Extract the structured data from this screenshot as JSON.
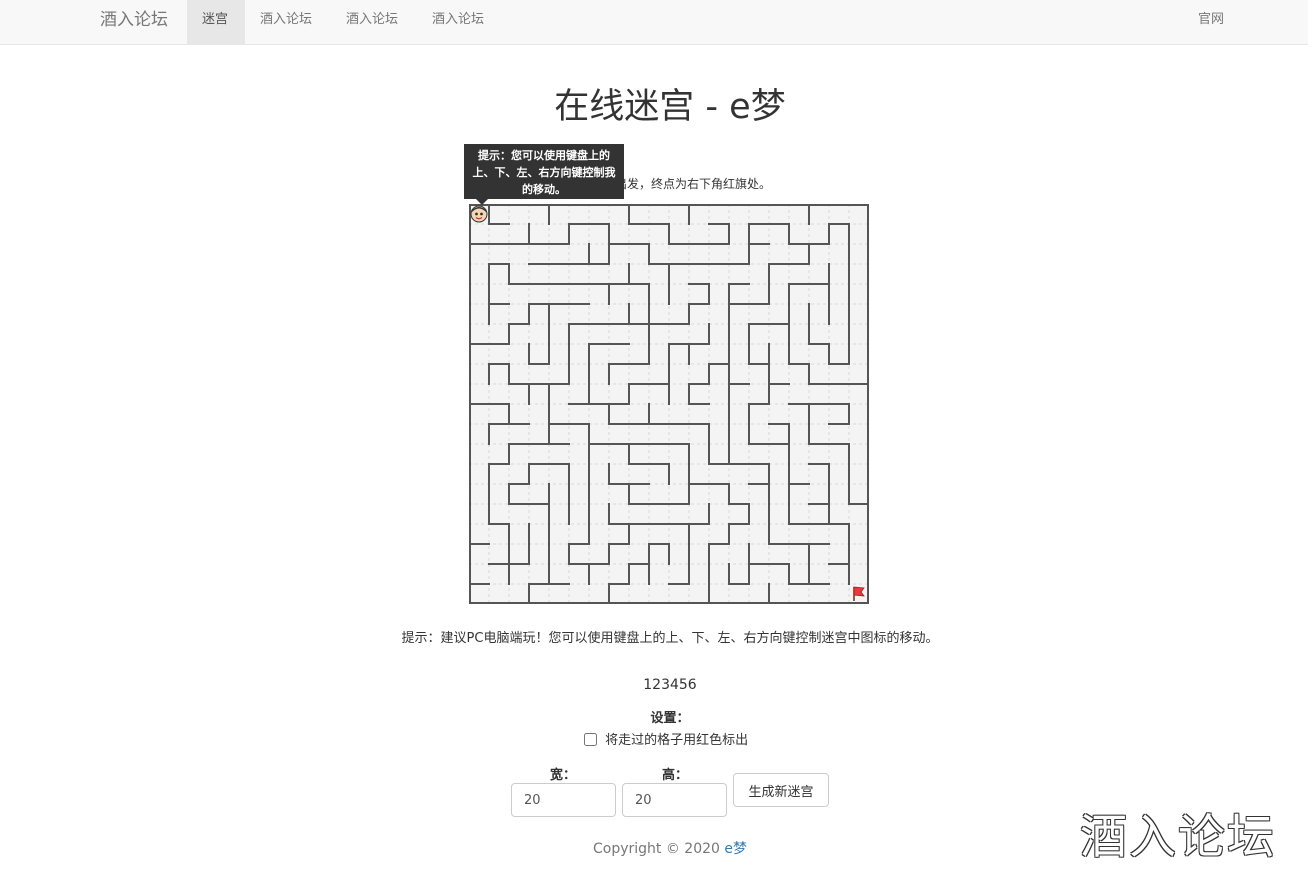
{
  "navbar": {
    "brand": "酒入论坛",
    "items": [
      {
        "label": "迷宫",
        "active": true
      },
      {
        "label": "酒入论坛",
        "active": false
      },
      {
        "label": "酒入论坛",
        "active": false
      },
      {
        "label": "酒入论坛",
        "active": false
      }
    ],
    "right_link": "官网"
  },
  "main": {
    "title": "在线迷宫 - e梦",
    "instruction": "从左上角出发，终点为右下角红旗处。",
    "tooltip": "提示：您可以使用键盘上的上、下、左、右方向键控制我的移动。",
    "hint": "提示：建议PC电脑端玩！您可以使用键盘上的上、下、左、右方向键控制迷宫中图标的移动。",
    "counter": "123456"
  },
  "maze": {
    "columns": 20,
    "rows": 20,
    "wall_color": "#555555",
    "floor_color": "#f4f4f4"
  },
  "settings": {
    "label": "设置：",
    "mark_path_label": "将走过的格子用红色标出",
    "mark_path_checked": false,
    "width_label": "宽：",
    "height_label": "高：",
    "width_value": "20",
    "height_value": "20",
    "generate_button": "生成新迷宫"
  },
  "footer": {
    "copyright": "Copyright © 2020",
    "author": "e梦"
  },
  "watermark": "酒入论坛",
  "colors": {
    "navbar_bg": "#f8f8f8",
    "tooltip_bg": "#333333",
    "link": "#337ab7"
  }
}
